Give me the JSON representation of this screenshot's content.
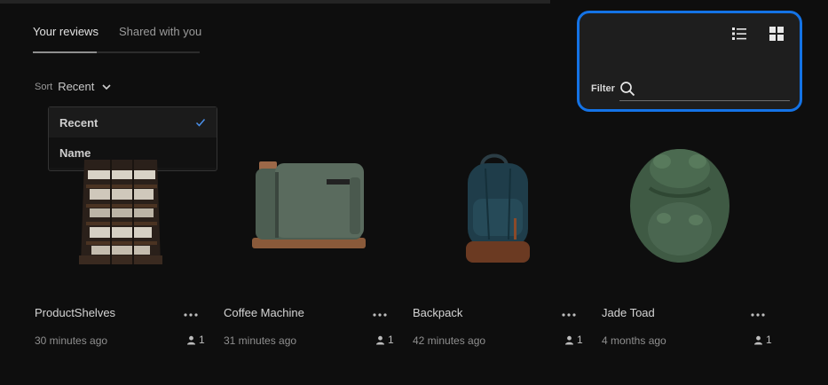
{
  "tabs": [
    {
      "label": "Your reviews",
      "active": true
    },
    {
      "label": "Shared with you",
      "active": false
    }
  ],
  "sort": {
    "label": "Sort",
    "value": "Recent",
    "options": [
      {
        "label": "Recent",
        "selected": true
      },
      {
        "label": "Name",
        "selected": false
      }
    ]
  },
  "filter": {
    "label": "Filter",
    "value": "",
    "placeholder": ""
  },
  "icons": {
    "list_view": "list-view-icon",
    "grid_view": "grid-view-icon",
    "search": "search-icon",
    "more": "more-icon",
    "user": "user-icon"
  },
  "colors": {
    "accent": "#1473e6",
    "background": "#0e0e0e",
    "panel": "#1e1e1e"
  },
  "cards": [
    {
      "title": "ProductShelves",
      "time": "30 minutes ago",
      "users": "1",
      "thumbnail": "product-shelves-model"
    },
    {
      "title": "Coffee Machine",
      "time": "31 minutes ago",
      "users": "1",
      "thumbnail": "coffee-machine-model"
    },
    {
      "title": "Backpack",
      "time": "42 minutes ago",
      "users": "1",
      "thumbnail": "backpack-model"
    },
    {
      "title": "Jade Toad",
      "time": "4 months ago",
      "users": "1",
      "thumbnail": "jade-toad-model"
    }
  ]
}
